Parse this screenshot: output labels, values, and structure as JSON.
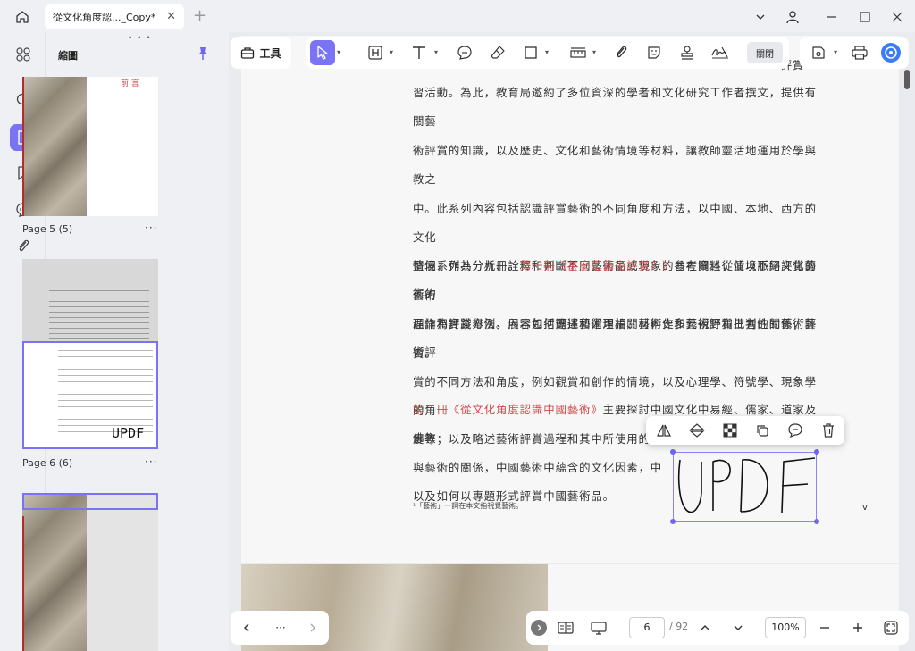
{
  "titlebar": {
    "tab_title": "從文化角度認..._Copy*",
    "new_tab": "+"
  },
  "thumbnails": {
    "header": "縮圖",
    "items": [
      {
        "label": "Page 5 (5)",
        "heading": "前 言"
      },
      {
        "label": "Page 6 (6)",
        "signature": "UPDF"
      },
      {
        "label": ""
      }
    ],
    "more": "···"
  },
  "toolbar": {
    "tools_label": "工具",
    "close_label": "關閉"
  },
  "document": {
    "cut_text": "評賞",
    "para1": [
      "習活動。為此，教育局邀約了多位資深的學者和文化研究工作者撰文，提供有關藝",
      "術評賞的知識，以及歷史、文化和藝術情境等材料，讓教師靈活地運用於學與教之",
      "中。此系列內容包括認識評賞藝術的不同角度和方法，以中國、本地、西方的文化",
      "情境，作為分析、詮釋和判斷不同藝術品或現象的參考資料；並以不同文化的藝術",
      "品作為評賞舉例，展示如何選擇和運用相關材料作多元視野和批判性的藝術評賞。"
    ],
    "para2_prefix": "整個系列共分九冊。",
    "para2_red": "第一冊《甚麼是藝術評賞？》",
    "para2_rest": "旨在闡述從情境脈絡評賞藝術的",
    "para2_lines": [
      "理論和實踐方法。內容包括簡述藝術理論、藝術史和藝術評賞三者的關係；藝術評",
      "賞的不同方法和角度，例如觀賞和創作的情境，以及心理學、符號學、現象學的角",
      "度等；以及略述藝術評賞過程和其中所使用的語言。"
    ],
    "para3_red": "第二冊《從文化角度認識中國藝術》",
    "para3_rest": "主要探討中國文化中易經、儒家、道家及佛教",
    "para3_line2": "與藝術的關係，中國藝術中蘊含的文化因素，中",
    "para3_line3": "以及如何以專題形式評賞中國藝術品。",
    "footnote": "¹「藝術」一詞在本文指視覺藝術。",
    "v_mark": "v",
    "signature": "UPDF"
  },
  "bottom": {
    "more": "···",
    "page_current": "6",
    "page_total": "/ 92",
    "zoom": "100%"
  }
}
